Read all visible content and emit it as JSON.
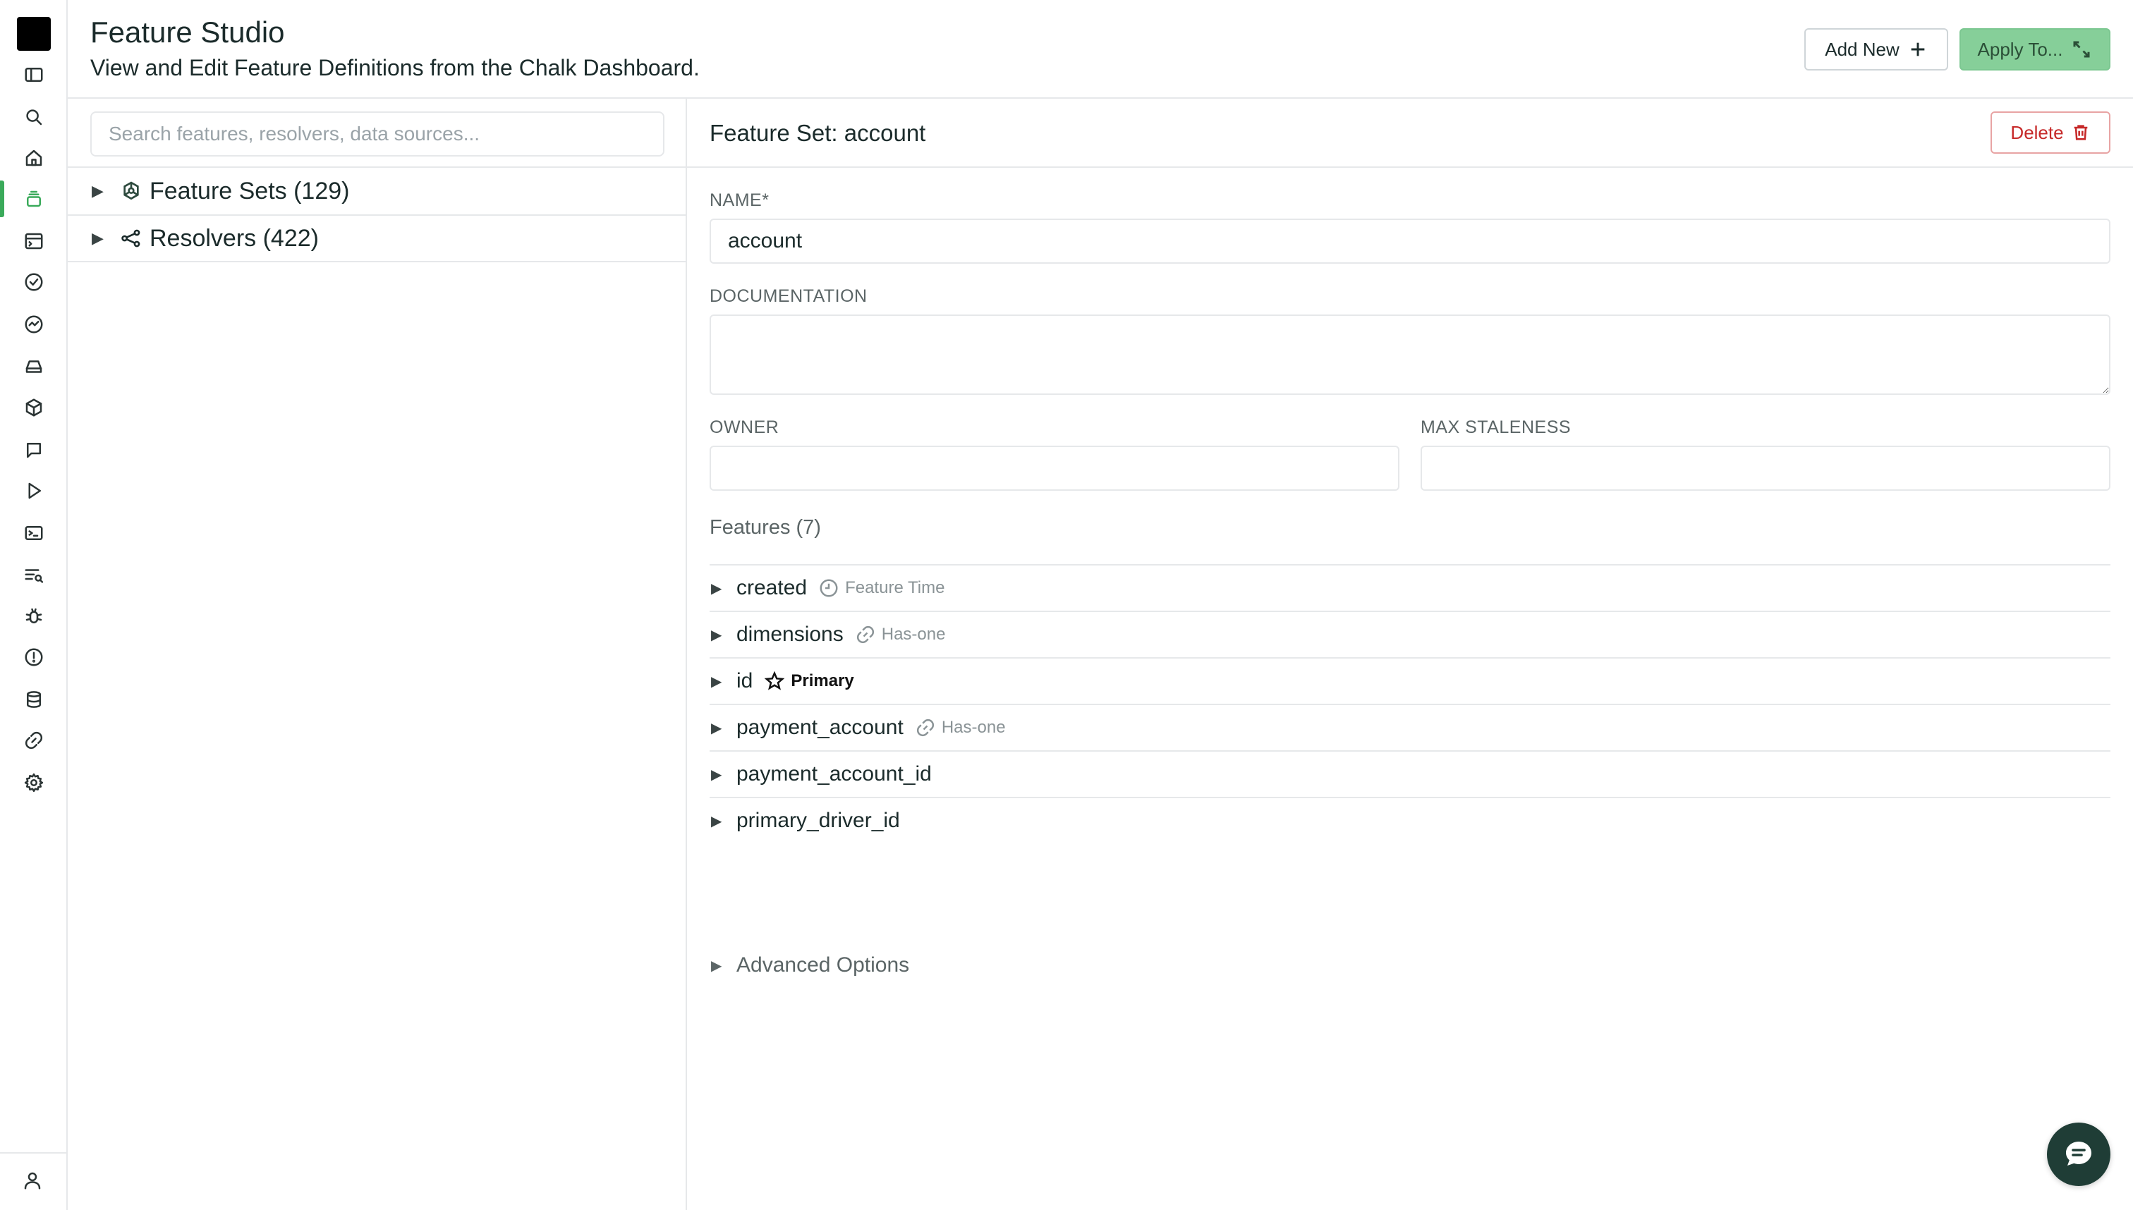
{
  "header": {
    "title": "Feature Studio",
    "subtitle": "View and Edit Feature Definitions from the Chalk Dashboard.",
    "add_new_label": "Add New",
    "apply_label": "Apply To..."
  },
  "sidebar": {
    "icons": [
      "sidebar-toggle-icon",
      "search-icon",
      "home-icon",
      "feature-store-icon",
      "dashboard-icon",
      "check-circle-icon",
      "activity-icon",
      "storage-icon",
      "cube-icon",
      "comment-icon",
      "play-icon",
      "terminal-icon",
      "query-list-icon",
      "bug-icon",
      "alert-icon",
      "database-icon",
      "link-icon",
      "gear-icon",
      "user-icon"
    ],
    "active": "feature-store-icon"
  },
  "left_panel": {
    "search_placeholder": "Search features, resolvers, data sources...",
    "tree": [
      {
        "label": "Feature Sets (129)",
        "icon": "feature-set-icon"
      },
      {
        "label": "Resolvers (422)",
        "icon": "resolver-icon"
      }
    ]
  },
  "detail": {
    "title": "Feature Set: account",
    "delete_label": "Delete",
    "name_label": "NAME*",
    "name_value": "account",
    "documentation_label": "DOCUMENTATION",
    "owner_label": "OWNER",
    "max_staleness_label": "MAX STALENESS",
    "features_title": "Features (7)",
    "features": [
      {
        "name": "created",
        "badge": "Feature Time",
        "badge_icon": "clock-icon"
      },
      {
        "name": "dimensions",
        "badge": "Has-one",
        "badge_icon": "link-icon"
      },
      {
        "name": "id",
        "badge": "Primary",
        "badge_icon": "star-icon"
      },
      {
        "name": "payment_account",
        "badge": "Has-one",
        "badge_icon": "link-icon"
      },
      {
        "name": "payment_account_id",
        "badge": "",
        "badge_icon": ""
      },
      {
        "name": "primary_driver_id",
        "badge": "",
        "badge_icon": ""
      }
    ],
    "advanced_label": "Advanced Options"
  },
  "colors": {
    "accent_green": "#3aaa5a",
    "apply_button_bg": "#86cf99",
    "delete_red": "#c62828",
    "chat_bg": "#1f3d36"
  }
}
